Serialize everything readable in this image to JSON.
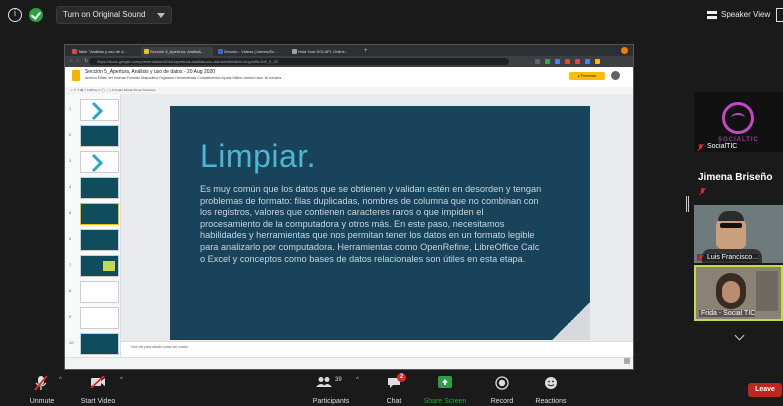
{
  "zoom": {
    "top": {
      "original_sound_label": "Turn on Original Sound",
      "speaker_view_label": "Speaker View"
    },
    "browser": {
      "tabs": [
        {
          "label": "Taller \"Análisis y uso de d...",
          "color": "#ea4335"
        },
        {
          "label": "Sección 5_Apertura, Análisis...",
          "color": "#fbbc04"
        },
        {
          "label": "Zenodo - Videos (Jueves/Ex...",
          "color": "#1a73e8"
        },
        {
          "label": "Hola Your DOI API, Online...",
          "color": "#9aa0a6"
        }
      ],
      "url": "https://docs.google.com/presentation/d/1ks1apertura-analisis-uso-datos/edit#slide=id.g4cf9c1b9_0_33"
    },
    "docs": {
      "title": "Sección 5_Apertura, Análisis y uso de datos - 20 Aug 2020",
      "menu": "Archivo  Editar  Ver  Insertar  Formato  Diapositiva  Organizar  Herramientas  Complementos  Ayuda   Último cambio hace 16 minutos",
      "toolbar": "+  ↶  ↷  🖶  ⌖  100%  ▸  ▭  ◯  ⬚  ╲  ▾   Fondo  Diseño  Tema  Transición",
      "present_label": "▸ Presentar",
      "notes": "Haz clic para añadir notas del orador",
      "slide": {
        "title": "Limpiar.",
        "body": "Es muy común que los datos que se obtienen y validan estén en desorden y tengan problemas de formato: filas duplicadas, nombres de columna que no combinan con los registros, valores que contienen caracteres raros o que impiden el procesamiento de la computadora y otros más. En este paso, necesitamos habilidades y herramientas que nos permitan tener los datos en un formato legible para analizarlo por computadora. Herramientas como OpenRefine, LibreOffice Calc o Excel y conceptos como bases de datos relacionales son útiles en esta etapa."
      },
      "thumb_numbers": [
        "1",
        "2",
        "3",
        "4",
        "5",
        "6",
        "7",
        "8",
        "9",
        "10"
      ]
    },
    "participants_panel": {
      "tiles": [
        {
          "name": "SocialTIC",
          "logo_text": "SOCIALTIC"
        },
        {
          "name": "Jimena Briseño"
        },
        {
          "name": "Luis Francisco..."
        },
        {
          "name": "Frida - Social TIC"
        }
      ]
    },
    "controls": {
      "unmute": "Unmute",
      "start_video": "Start Video",
      "participants": "Participants",
      "participants_count": "39",
      "chat": "Chat",
      "chat_badge": "2",
      "share_screen": "Share Screen",
      "record": "Record",
      "reactions": "Reactions",
      "leave": "Leave"
    },
    "colors": {
      "share_green": "#2ea043",
      "leave_red": "#c0261f",
      "slide_bg": "#18435a",
      "slide_title": "#4db6d0",
      "active_speaker_border": "#c5d94a"
    }
  }
}
